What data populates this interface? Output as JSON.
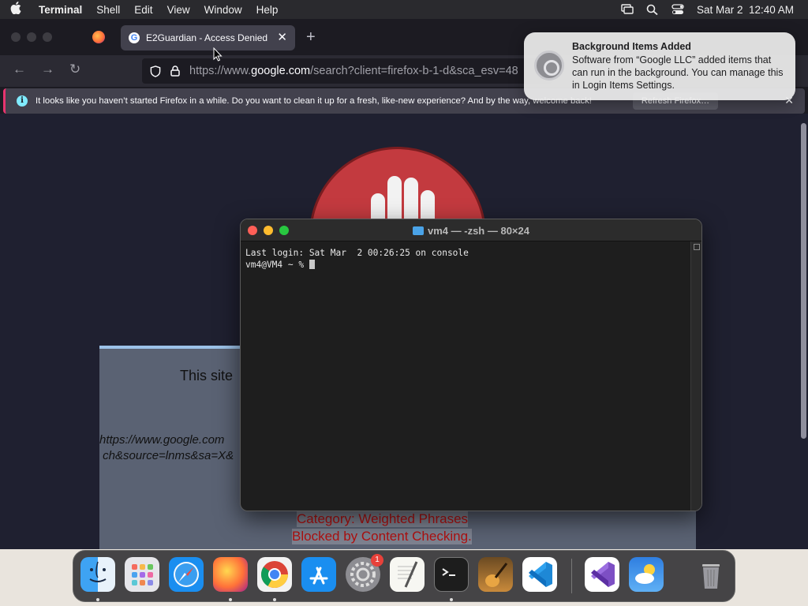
{
  "menubar": {
    "app_name": "Terminal",
    "menus": [
      "Shell",
      "Edit",
      "View",
      "Window",
      "Help"
    ],
    "clock": "Sat Mar 2  12:40 AM"
  },
  "firefox": {
    "tab_title": "E2Guardian - Access Denied",
    "tab_favicon_letter": "G",
    "url_prefix": "https://www.",
    "url_host": "google.com",
    "url_rest": "/search?client=firefox-b-1-d&sca_esv=48",
    "infobar_text": "It looks like you haven’t started Firefox in a while. Do you want to clean it up for a fresh, like-new experience? And by the way, welcome back!",
    "refresh_label": "Refresh Firefox…"
  },
  "blocked_page": {
    "title": "This site",
    "url_line1": "https://www.google.com",
    "url_line2": " ch&source=lnms&sa=X&",
    "category": "Category: Weighted Phrases",
    "reason": "Blocked by Content Checking."
  },
  "terminal": {
    "title": "vm4 — -zsh — 80×24",
    "line1": "Last login: Sat Mar  2 00:26:25 on console",
    "prompt": "vm4@VM4 ~ % "
  },
  "notification": {
    "title": "Background Items Added",
    "body": "Software from “Google LLC” added items that can run in the background. You can manage this in Login Items Settings."
  },
  "dock": {
    "items": [
      "finder",
      "launchpad",
      "safari",
      "firefox",
      "chrome",
      "app-store",
      "system-settings",
      "textedit",
      "terminal",
      "garageband",
      "vscode",
      "visual-studio",
      "weather",
      "trash"
    ],
    "settings_badge": "1"
  }
}
